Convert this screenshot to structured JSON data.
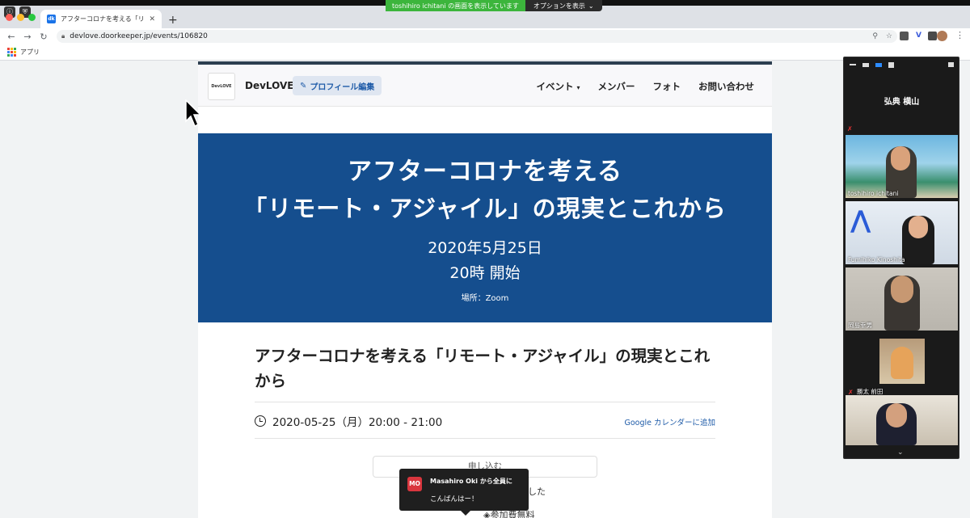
{
  "share_banner": {
    "text": "toshihiro ichitani の画面を表示しています",
    "options": "オプションを表示"
  },
  "browser": {
    "tab_title": "アフターコロナを考える「リモート・アジャイル」の現実とこれから",
    "tab_favicon": "dk",
    "url": "devlove.doorkeeper.jp/events/106820",
    "bookmarks_apps": "アプリ"
  },
  "site": {
    "logo_text": "DevLOVE",
    "name": "DevLOVE",
    "profile_button": "プロフィール編集",
    "menu": [
      "イベント",
      "メンバー",
      "フォト",
      "お問い合わせ"
    ]
  },
  "banner": {
    "line1": "アフターコロナを考える",
    "line2": "「リモート・アジャイル」の現実とこれから",
    "date": "2020年5月25日",
    "time": "20時 開始",
    "place": "場所：Zoom"
  },
  "event": {
    "title": "アフターコロナを考える「リモート・アジャイル」の現実とこれから",
    "datetime": "2020-05-25（月）20:00 - 21:00",
    "google_calendar": "Google カレンダーに追加",
    "apply_button": "申し込む",
    "partial_text": "した",
    "fee_text": "参加費無料"
  },
  "chat": {
    "initials": "MO",
    "from": "Masahiro Oki から全員に",
    "message": "こんばんはー！"
  },
  "zoom": {
    "active_speaker": "弘典 横山",
    "participants": [
      {
        "name": "toshihiro ichitani"
      },
      {
        "name": "Fumihiko Kinoshita"
      },
      {
        "name": "岡島幸男"
      },
      {
        "name": "勝太 前田"
      },
      {
        "name": ""
      }
    ]
  },
  "colors": {
    "banner_bg": "#154e8e",
    "accent_link": "#1e5ba8",
    "share_green": "#3cb53c",
    "chat_badge": "#d9363e"
  }
}
